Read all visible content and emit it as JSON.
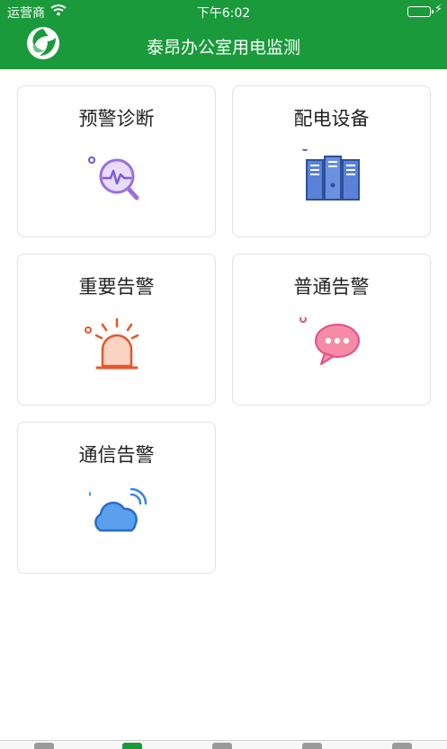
{
  "status_bar": {
    "carrier": "运营商",
    "time": "下午6:02"
  },
  "header": {
    "title": "泰昂办公室用电监测",
    "logo_icon": "app-logo-icon",
    "background_color": "#1a9a3b"
  },
  "cards": [
    {
      "label": "预警诊断",
      "icon": "diagnosis-icon"
    },
    {
      "label": "配电设备",
      "icon": "cabinet-icon"
    },
    {
      "label": "重要告警",
      "icon": "alarm-light-icon"
    },
    {
      "label": "普通告警",
      "icon": "chat-bubble-icon"
    },
    {
      "label": "通信告警",
      "icon": "cloud-signal-icon"
    }
  ],
  "colors": {
    "accent": "#1a9a3b",
    "diagnosis": "#9b6fe0",
    "cabinet": "#4a6fd0",
    "alarm": "#e4572e",
    "chat": "#f06b8a",
    "cloud": "#3a86e0"
  }
}
